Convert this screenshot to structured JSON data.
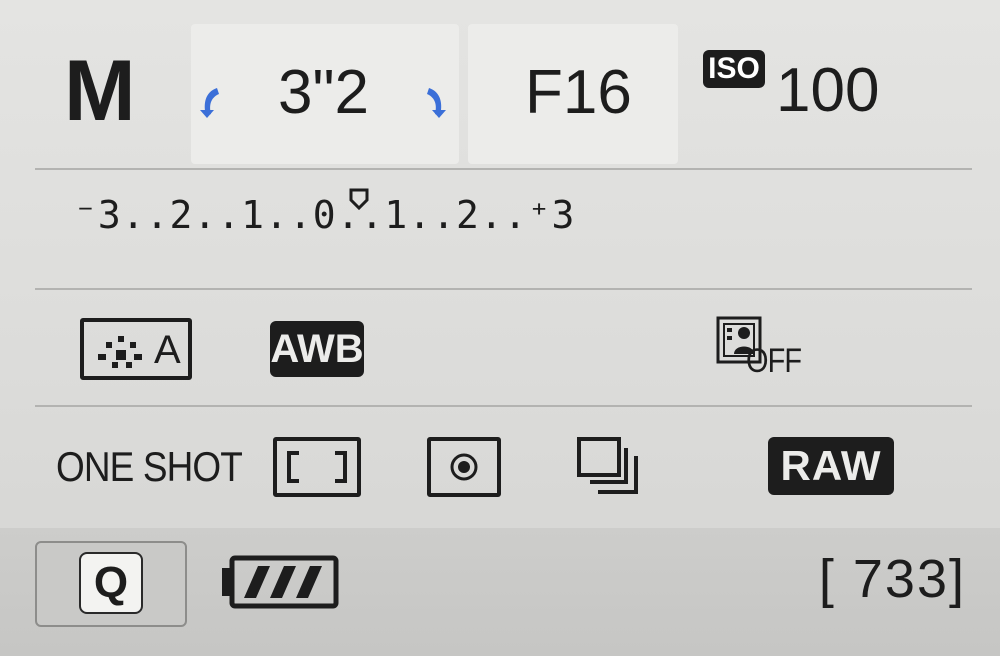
{
  "top": {
    "mode": "M",
    "shutter_speed": "3\"2",
    "aperture": "F16",
    "iso_badge": "ISO",
    "iso_value": "100"
  },
  "exposure": {
    "scale": "⁻3..2..1..0..1..2..⁺3",
    "indicator_value": 0
  },
  "settings_row1": {
    "picture_style": "A",
    "white_balance": "AWB",
    "self_timer": "OFF"
  },
  "settings_row2": {
    "af_mode": "ONE SHOT",
    "image_quality": "RAW"
  },
  "bottom": {
    "quick_button": "Q",
    "shots_remaining": "[ 733]",
    "battery_level": 0.75
  },
  "colors": {
    "arrow_accent": "#3b6fd8",
    "text": "#1d1d1d",
    "background": "#e2e2e0"
  }
}
